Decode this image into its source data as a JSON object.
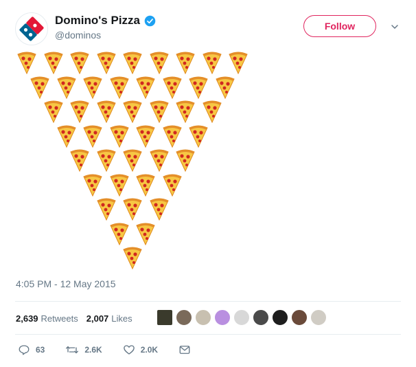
{
  "account": {
    "display_name": "Domino's Pizza",
    "handle": "@dominos",
    "verified": true,
    "follow_label": "Follow",
    "brand_color": "#006491",
    "accent_color": "#e0245e"
  },
  "tweet": {
    "content_emoji": "pizza",
    "pizza_rows": [
      9,
      8,
      7,
      6,
      5,
      4,
      3,
      2,
      1
    ],
    "timestamp": "4:05 PM - 12 May 2015"
  },
  "stats": {
    "retweets_count": "2,639",
    "retweets_label": "Retweets",
    "likes_count": "2,007",
    "likes_label": "Likes",
    "liker_avatar_colors": [
      "#3a3a2c",
      "#7a6a5a",
      "#c8c0b0",
      "#b98fe0",
      "#d8d8d8",
      "#4a4a4a",
      "#1e1e1e",
      "#6a4a3a",
      "#d0ccc4"
    ]
  },
  "actions": {
    "replies": "63",
    "retweets": "2.6K",
    "likes": "2.0K"
  }
}
